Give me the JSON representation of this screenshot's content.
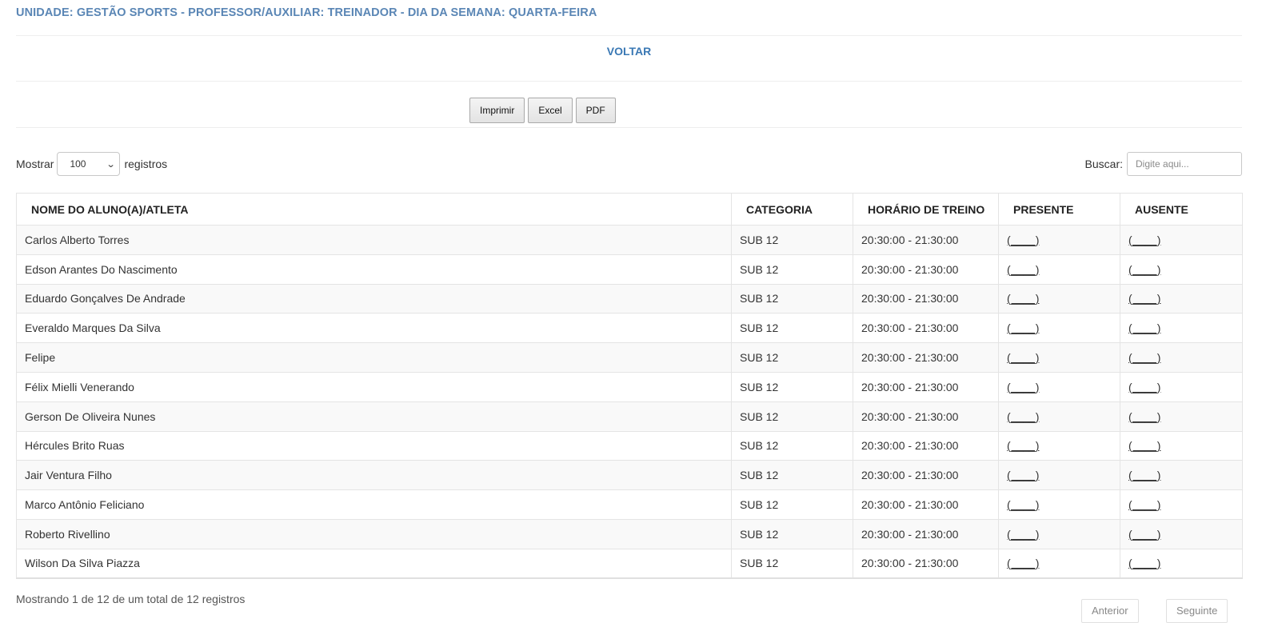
{
  "header": {
    "title": "UNIDADE: GESTÃO SPORTS - PROFESSOR/AUXILIAR: TREINADOR - DIA DA SEMANA: QUARTA-FEIRA",
    "back_label": "VOLTAR"
  },
  "toolbar": {
    "print_label": "Imprimir",
    "excel_label": "Excel",
    "pdf_label": "PDF"
  },
  "length": {
    "prefix": "Mostrar",
    "selected": "100",
    "suffix": "registros"
  },
  "search": {
    "label": "Buscar:",
    "placeholder": "Digite aqui..."
  },
  "table": {
    "headers": [
      "NOME DO ALUNO(A)/ATLETA",
      "CATEGORIA",
      "HORÁRIO DE TREINO",
      "PRESENTE",
      "AUSENTE"
    ],
    "rows": [
      {
        "name": "Carlos Alberto Torres",
        "category": "SUB 12",
        "time": "20:30:00 - 21:30:00",
        "present": "(____)",
        "absent": "(____)"
      },
      {
        "name": "Edson Arantes Do Nascimento",
        "category": "SUB 12",
        "time": "20:30:00 - 21:30:00",
        "present": "(____)",
        "absent": "(____)"
      },
      {
        "name": "Eduardo Gonçalves De Andrade",
        "category": "SUB 12",
        "time": "20:30:00 - 21:30:00",
        "present": "(____)",
        "absent": "(____)"
      },
      {
        "name": "Everaldo Marques Da Silva",
        "category": "SUB 12",
        "time": "20:30:00 - 21:30:00",
        "present": "(____)",
        "absent": "(____)"
      },
      {
        "name": "Felipe",
        "category": "SUB 12",
        "time": "20:30:00 - 21:30:00",
        "present": "(____)",
        "absent": "(____)"
      },
      {
        "name": "Félix Mielli Venerando",
        "category": "SUB 12",
        "time": "20:30:00 - 21:30:00",
        "present": "(____)",
        "absent": "(____)"
      },
      {
        "name": "Gerson De Oliveira Nunes",
        "category": "SUB 12",
        "time": "20:30:00 - 21:30:00",
        "present": "(____)",
        "absent": "(____)"
      },
      {
        "name": "Hércules Brito Ruas",
        "category": "SUB 12",
        "time": "20:30:00 - 21:30:00",
        "present": "(____)",
        "absent": "(____)"
      },
      {
        "name": "Jair Ventura Filho",
        "category": "SUB 12",
        "time": "20:30:00 - 21:30:00",
        "present": "(____)",
        "absent": "(____)"
      },
      {
        "name": "Marco Antônio Feliciano",
        "category": "SUB 12",
        "time": "20:30:00 - 21:30:00",
        "present": "(____)",
        "absent": "(____)"
      },
      {
        "name": "Roberto Rivellino",
        "category": "SUB 12",
        "time": "20:30:00 - 21:30:00",
        "present": "(____)",
        "absent": "(____)"
      },
      {
        "name": "Wilson Da Silva Piazza",
        "category": "SUB 12",
        "time": "20:30:00 - 21:30:00",
        "present": "(____)",
        "absent": "(____)"
      }
    ]
  },
  "footer": {
    "info": "Mostrando 1 de 12 de um total de 12 registros",
    "prev_label": "Anterior",
    "next_label": "Seguinte"
  }
}
